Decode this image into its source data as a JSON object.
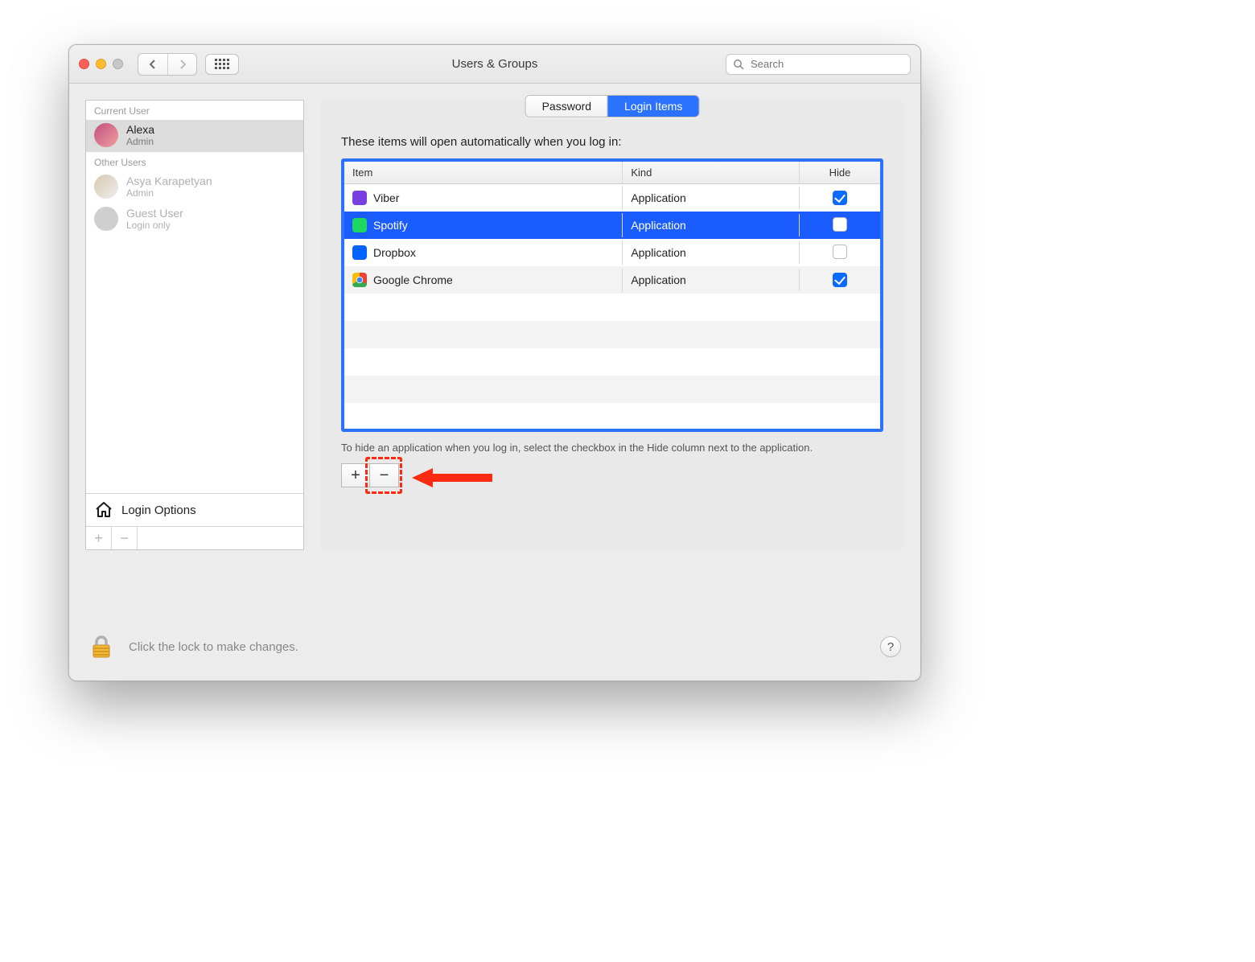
{
  "window": {
    "title": "Users & Groups",
    "search_placeholder": "Search"
  },
  "sidebar": {
    "current_user_header": "Current User",
    "other_users_header": "Other Users",
    "users": [
      {
        "name": "Alexa",
        "role": "Admin",
        "selected": true,
        "avatar_bg": "linear-gradient(135deg,#c05080,#f0a0a0)"
      },
      {
        "name": "Asya Karapetyan",
        "role": "Admin",
        "dim": true,
        "avatar_bg": "linear-gradient(135deg,#d8c8b0,#eee)"
      },
      {
        "name": "Guest User",
        "role": "Login only",
        "dim": true,
        "avatar_bg": "#cfcfcf"
      }
    ],
    "login_options_label": "Login Options"
  },
  "tabs": {
    "password": "Password",
    "login_items": "Login Items",
    "active": "login_items"
  },
  "main": {
    "heading": "These items will open automatically when you log in:",
    "columns": {
      "item": "Item",
      "kind": "Kind",
      "hide": "Hide"
    },
    "rows": [
      {
        "name": "Viber",
        "kind": "Application",
        "hide": true,
        "selected": false,
        "icon_bg": "#7a3fe0"
      },
      {
        "name": "Spotify",
        "kind": "Application",
        "hide": false,
        "selected": true,
        "icon_bg": "#1ed760"
      },
      {
        "name": "Dropbox",
        "kind": "Application",
        "hide": false,
        "selected": false,
        "icon_bg": "#0062ff"
      },
      {
        "name": "Google Chrome",
        "kind": "Application",
        "hide": true,
        "selected": false,
        "icon_bg": "radial-gradient(circle at 50% 50%, #4285f4 25%, #fff 27%, #fff 32%, transparent 34%), conic-gradient(#ea4335 0 120deg, #34a853 120deg 240deg, #fbbc05 240deg 360deg)"
      }
    ],
    "hint": "To hide an application when you log in, select the checkbox in the Hide column next to the application."
  },
  "footer": {
    "lock_text": "Click the lock to make changes.",
    "help_symbol": "?"
  },
  "annotation": {
    "target": "remove-login-item-button",
    "arrow_color": "#ff2a12"
  }
}
